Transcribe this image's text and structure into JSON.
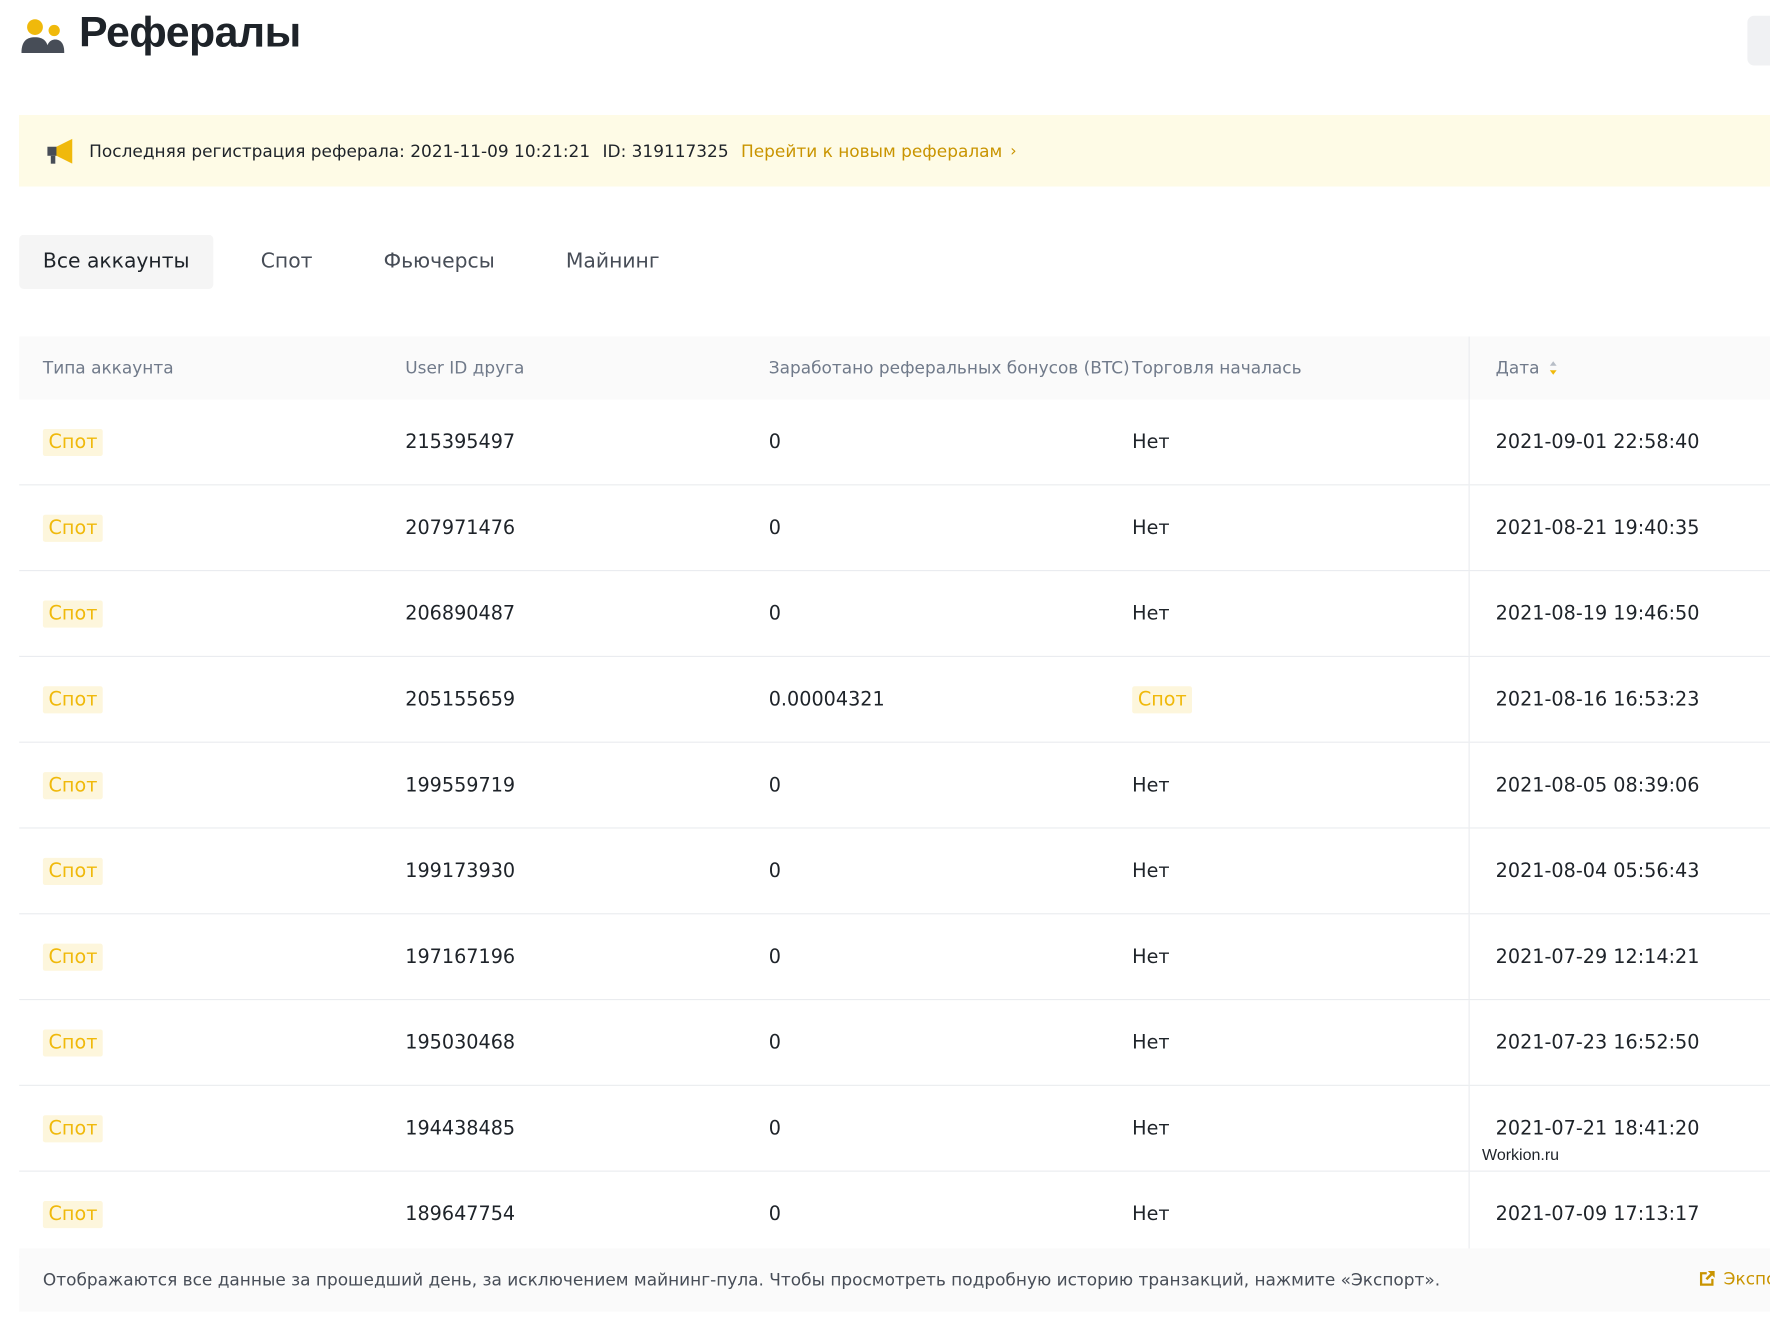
{
  "header": {
    "title": "Рефералы",
    "icon": "people-icon"
  },
  "notice": {
    "icon": "megaphone-icon",
    "text": "Последняя регистрация реферала: 2021-11-09 10:21:21",
    "id_text": "ID: 319117325",
    "link": "Перейти к новым рефералам"
  },
  "tabs": [
    {
      "label": "Все аккаунты",
      "active": true
    },
    {
      "label": "Спот",
      "active": false
    },
    {
      "label": "Фьючерсы",
      "active": false
    },
    {
      "label": "Майнинг",
      "active": false
    }
  ],
  "table": {
    "columns": [
      "Типа аккаунта",
      "User ID друга",
      "Заработано реферальных бонусов (BTC)",
      "Торговля началась",
      "Дата"
    ],
    "rows": [
      {
        "type": "Спот",
        "user_id": "215395497",
        "bonus": "0",
        "started": "Нет",
        "started_badge": false,
        "date": "2021-09-01 22:58:40"
      },
      {
        "type": "Спот",
        "user_id": "207971476",
        "bonus": "0",
        "started": "Нет",
        "started_badge": false,
        "date": "2021-08-21 19:40:35"
      },
      {
        "type": "Спот",
        "user_id": "206890487",
        "bonus": "0",
        "started": "Нет",
        "started_badge": false,
        "date": "2021-08-19 19:46:50"
      },
      {
        "type": "Спот",
        "user_id": "205155659",
        "bonus": "0.00004321",
        "started": "Спот",
        "started_badge": true,
        "date": "2021-08-16 16:53:23"
      },
      {
        "type": "Спот",
        "user_id": "199559719",
        "bonus": "0",
        "started": "Нет",
        "started_badge": false,
        "date": "2021-08-05 08:39:06"
      },
      {
        "type": "Спот",
        "user_id": "199173930",
        "bonus": "0",
        "started": "Нет",
        "started_badge": false,
        "date": "2021-08-04 05:56:43"
      },
      {
        "type": "Спот",
        "user_id": "197167196",
        "bonus": "0",
        "started": "Нет",
        "started_badge": false,
        "date": "2021-07-29 12:14:21"
      },
      {
        "type": "Спот",
        "user_id": "195030468",
        "bonus": "0",
        "started": "Нет",
        "started_badge": false,
        "date": "2021-07-23 16:52:50"
      },
      {
        "type": "Спот",
        "user_id": "194438485",
        "bonus": "0",
        "started": "Нет",
        "started_badge": false,
        "date": "2021-07-21 18:41:20"
      },
      {
        "type": "Спот",
        "user_id": "189647754",
        "bonus": "0",
        "started": "Нет",
        "started_badge": false,
        "date": "2021-07-09 17:13:17"
      }
    ]
  },
  "footer": {
    "message": "Отображаются все данные за прошедший день, за исключением майнинг-пула. Чтобы просмотреть подробную историю транзакций, нажмите «Экспорт».",
    "export_label": "Экспо",
    "export_icon": "external-link-icon"
  },
  "watermark": "Workion.ru",
  "colors": {
    "accent": "#f0b90b",
    "link": "#c99400",
    "notice_bg": "#fefbe6",
    "badge_bg": "#fdf6dc"
  }
}
